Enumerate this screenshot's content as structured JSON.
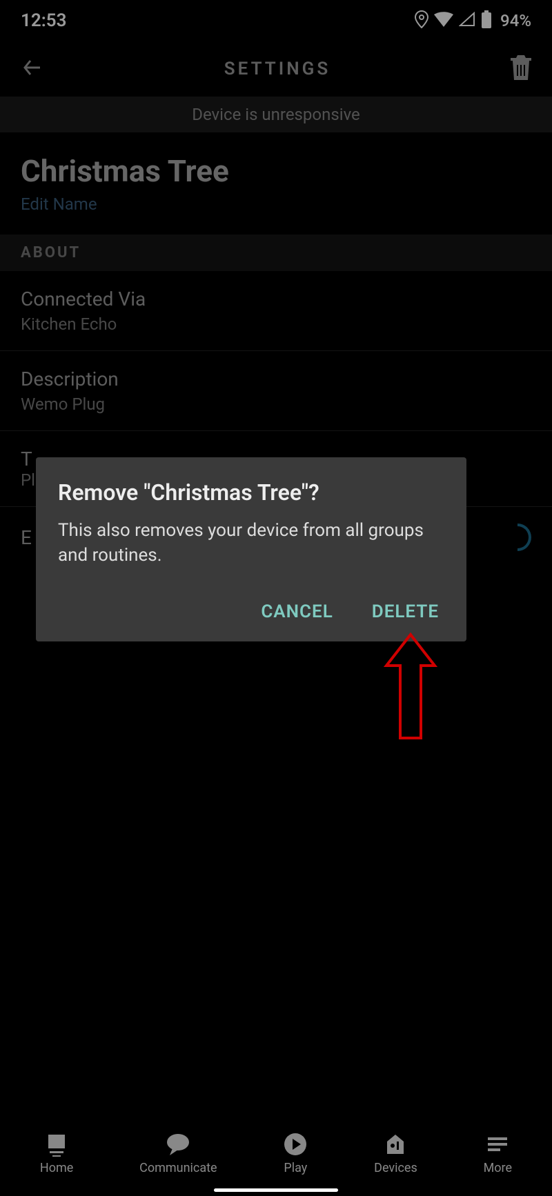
{
  "status": {
    "time": "12:53",
    "battery": "94%"
  },
  "header": {
    "title": "SETTINGS"
  },
  "banner": {
    "text": "Device is unresponsive"
  },
  "device": {
    "name": "Christmas Tree",
    "edit_label": "Edit Name"
  },
  "about": {
    "section_label": "ABOUT",
    "connected_via": {
      "label": "Connected Via",
      "value": "Kitchen Echo"
    },
    "description": {
      "label": "Description",
      "value": "Wemo Plug"
    },
    "type": {
      "label": "T",
      "value": "Pl"
    },
    "enabled": {
      "label": "E"
    }
  },
  "dialog": {
    "title": "Remove \"Christmas Tree\"?",
    "message": "This also removes your device from all groups and routines.",
    "cancel": "CANCEL",
    "delete": "DELETE"
  },
  "nav": {
    "home": "Home",
    "communicate": "Communicate",
    "play": "Play",
    "devices": "Devices",
    "more": "More"
  }
}
